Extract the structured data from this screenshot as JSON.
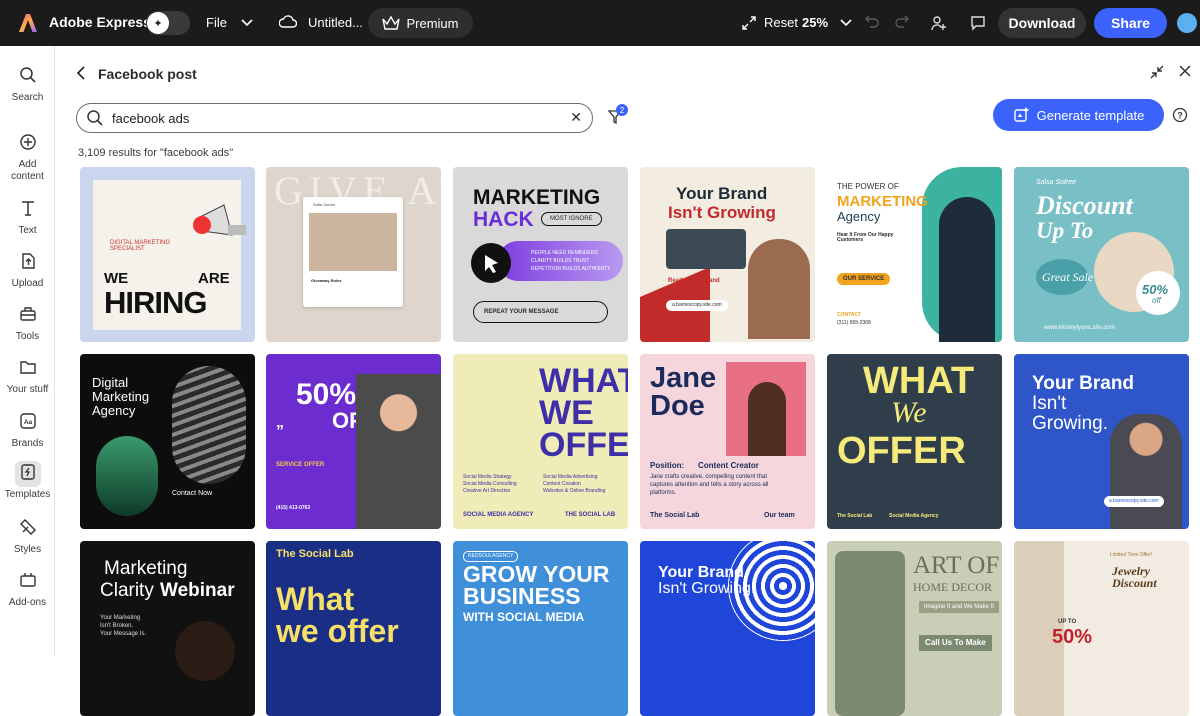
{
  "app": {
    "name": "Adobe Express",
    "file_label": "File",
    "doc_title": "Untitled...",
    "premium_label": "Premium",
    "reset_label": "Reset",
    "zoom": "25%",
    "download_label": "Download",
    "share_label": "Share"
  },
  "sidebar": {
    "items": [
      {
        "label": "Search"
      },
      {
        "label": "Add content"
      },
      {
        "label": "Text"
      },
      {
        "label": "Upload"
      },
      {
        "label": "Tools"
      },
      {
        "label": "Your stuff"
      },
      {
        "label": "Brands"
      },
      {
        "label": "Templates"
      },
      {
        "label": "Styles"
      },
      {
        "label": "Add-ons"
      }
    ]
  },
  "panel": {
    "title": "Facebook post",
    "search_value": "facebook ads",
    "filter_count": "2",
    "generate_label": "Generate template",
    "results_text": "3,109 results for \"facebook ads\""
  },
  "templates": {
    "t1": {
      "l1": "WE",
      "l2": "ARE",
      "l3": "HIRING",
      "sub": "DIGITAL MARKETING SPECIALIST"
    },
    "t2": {
      "bg": "GIVE AWAY",
      "post": "Giveaway Rules",
      "user": "Sofia Sorres"
    },
    "t3": {
      "l1": "MARKETING",
      "l2": "HACK",
      "tag": "MOST IGNORE",
      "b1": "PEOPLE NEED REMINDERS",
      "b2": "CLARITY BUILDS TRUST",
      "b3": "REPETITION BUILDS AUTHORITY",
      "btn": "REPEAT YOUR MESSAGE"
    },
    "t4": {
      "l1": "Your Brand",
      "l2": "Isn't Growing",
      "q": "Ready to fix it and scale smarter?",
      "url": "a.barnescopy.site.com"
    },
    "t5": {
      "l1": "THE POWER OF",
      "l2": "MARKETING",
      "l3": "Agency",
      "h": "Hear It From Our Happy Customers",
      "svc": "OUR SERVICE",
      "contact": "CONTACT",
      "phone": "(311) 555-2368"
    },
    "t6": {
      "brand": "Salsa Sotree",
      "l1": "Discount",
      "l2": "Up To",
      "badge": "Great Sale",
      "pct": "50%",
      "off": "off",
      "url": "www.kinsleylyons.site.com"
    },
    "t7": {
      "l1": "Digital",
      "l2": "Marketing",
      "l3": "Agency",
      "contact": "Contact Now"
    },
    "t8": {
      "pct": "50%",
      "off": "OFF",
      "svc": "SERVICE OFFER",
      "phone": "(415) 413-0763"
    },
    "t9": {
      "l1": "WHAT",
      "l2": "WE",
      "l3": "OFFER",
      "c1": "Social Media Strategy",
      "c2": "Social Media Consulting",
      "c3": "Creative Art Direction",
      "c4": "Social Media Advertising",
      "c5": "Content Creation",
      "c6": "Websites & Online Branding",
      "f1": "SOCIAL MEDIA AGENCY",
      "f2": "THE SOCIAL LAB"
    },
    "t10": {
      "l1": "Jane",
      "l2": "Doe",
      "pos": "Position:",
      "role": "Content Creator",
      "desc": "Jane crafts creative, compelling content that captures attention and tells a story across all platforms.",
      "f1": "The Social Lab",
      "f2": "Our team"
    },
    "t11": {
      "l1": "WHAT",
      "l2": "We",
      "l3": "OFFER",
      "f1": "The Social Lab",
      "f2": "Social Media Agency"
    },
    "t12": {
      "l1": "Your Brand",
      "l2": "Isn't",
      "l3": "Growing.",
      "url": "a.barnescopy.site.com"
    },
    "t13": {
      "l1": "Marketing",
      "l2": "Clarity",
      "l3": "Webinar",
      "s1": "Your Marketing",
      "s2": "Isn't Broken.",
      "s3": "Your Message Is."
    },
    "t14": {
      "top": "The Social Lab",
      "l1": "What",
      "l2": "we offer"
    },
    "t15": {
      "tag": "REDSOULAGENCY",
      "l1": "GROW YOUR",
      "l2": "BUSINESS",
      "l3": "WITH SOCIAL MEDIA"
    },
    "t16": {
      "l1": "Your Brand",
      "l2": "Isn't Growing."
    },
    "t17": {
      "l1": "ART OF",
      "l2": "HOME DECOR",
      "s": "Imagine It and We Make It",
      "btn": "Call Us To Make"
    },
    "t18": {
      "tag": "Limited Time Offer!",
      "l1": "Jewelry",
      "l2": "Discount",
      "upto": "UP TO",
      "pct": "50%"
    }
  }
}
